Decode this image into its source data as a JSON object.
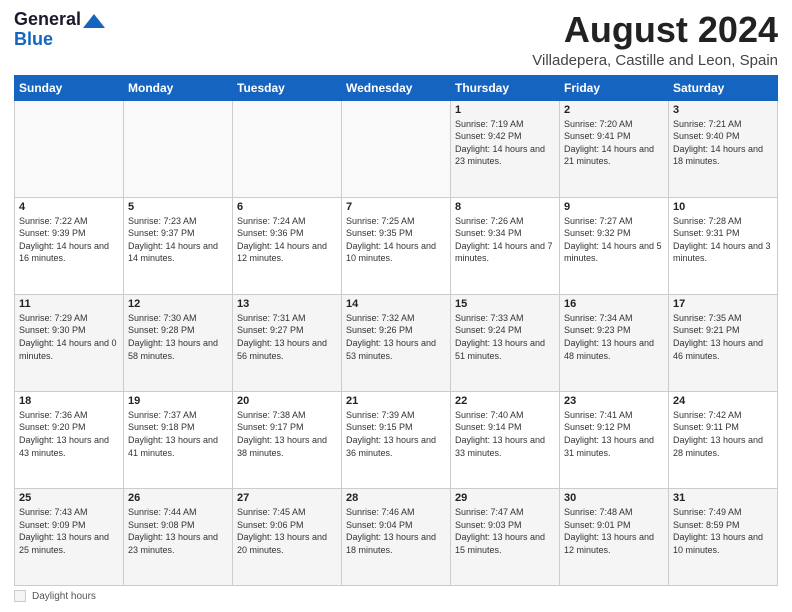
{
  "header": {
    "logo_line1": "General",
    "logo_line2": "Blue",
    "main_title": "August 2024",
    "subtitle": "Villadepera, Castille and Leon, Spain"
  },
  "calendar": {
    "days_of_week": [
      "Sunday",
      "Monday",
      "Tuesday",
      "Wednesday",
      "Thursday",
      "Friday",
      "Saturday"
    ],
    "weeks": [
      [
        {
          "day": "",
          "info": ""
        },
        {
          "day": "",
          "info": ""
        },
        {
          "day": "",
          "info": ""
        },
        {
          "day": "",
          "info": ""
        },
        {
          "day": "1",
          "info": "Sunrise: 7:19 AM\nSunset: 9:42 PM\nDaylight: 14 hours and 23 minutes."
        },
        {
          "day": "2",
          "info": "Sunrise: 7:20 AM\nSunset: 9:41 PM\nDaylight: 14 hours and 21 minutes."
        },
        {
          "day": "3",
          "info": "Sunrise: 7:21 AM\nSunset: 9:40 PM\nDaylight: 14 hours and 18 minutes."
        }
      ],
      [
        {
          "day": "4",
          "info": "Sunrise: 7:22 AM\nSunset: 9:39 PM\nDaylight: 14 hours and 16 minutes."
        },
        {
          "day": "5",
          "info": "Sunrise: 7:23 AM\nSunset: 9:37 PM\nDaylight: 14 hours and 14 minutes."
        },
        {
          "day": "6",
          "info": "Sunrise: 7:24 AM\nSunset: 9:36 PM\nDaylight: 14 hours and 12 minutes."
        },
        {
          "day": "7",
          "info": "Sunrise: 7:25 AM\nSunset: 9:35 PM\nDaylight: 14 hours and 10 minutes."
        },
        {
          "day": "8",
          "info": "Sunrise: 7:26 AM\nSunset: 9:34 PM\nDaylight: 14 hours and 7 minutes."
        },
        {
          "day": "9",
          "info": "Sunrise: 7:27 AM\nSunset: 9:32 PM\nDaylight: 14 hours and 5 minutes."
        },
        {
          "day": "10",
          "info": "Sunrise: 7:28 AM\nSunset: 9:31 PM\nDaylight: 14 hours and 3 minutes."
        }
      ],
      [
        {
          "day": "11",
          "info": "Sunrise: 7:29 AM\nSunset: 9:30 PM\nDaylight: 14 hours and 0 minutes."
        },
        {
          "day": "12",
          "info": "Sunrise: 7:30 AM\nSunset: 9:28 PM\nDaylight: 13 hours and 58 minutes."
        },
        {
          "day": "13",
          "info": "Sunrise: 7:31 AM\nSunset: 9:27 PM\nDaylight: 13 hours and 56 minutes."
        },
        {
          "day": "14",
          "info": "Sunrise: 7:32 AM\nSunset: 9:26 PM\nDaylight: 13 hours and 53 minutes."
        },
        {
          "day": "15",
          "info": "Sunrise: 7:33 AM\nSunset: 9:24 PM\nDaylight: 13 hours and 51 minutes."
        },
        {
          "day": "16",
          "info": "Sunrise: 7:34 AM\nSunset: 9:23 PM\nDaylight: 13 hours and 48 minutes."
        },
        {
          "day": "17",
          "info": "Sunrise: 7:35 AM\nSunset: 9:21 PM\nDaylight: 13 hours and 46 minutes."
        }
      ],
      [
        {
          "day": "18",
          "info": "Sunrise: 7:36 AM\nSunset: 9:20 PM\nDaylight: 13 hours and 43 minutes."
        },
        {
          "day": "19",
          "info": "Sunrise: 7:37 AM\nSunset: 9:18 PM\nDaylight: 13 hours and 41 minutes."
        },
        {
          "day": "20",
          "info": "Sunrise: 7:38 AM\nSunset: 9:17 PM\nDaylight: 13 hours and 38 minutes."
        },
        {
          "day": "21",
          "info": "Sunrise: 7:39 AM\nSunset: 9:15 PM\nDaylight: 13 hours and 36 minutes."
        },
        {
          "day": "22",
          "info": "Sunrise: 7:40 AM\nSunset: 9:14 PM\nDaylight: 13 hours and 33 minutes."
        },
        {
          "day": "23",
          "info": "Sunrise: 7:41 AM\nSunset: 9:12 PM\nDaylight: 13 hours and 31 minutes."
        },
        {
          "day": "24",
          "info": "Sunrise: 7:42 AM\nSunset: 9:11 PM\nDaylight: 13 hours and 28 minutes."
        }
      ],
      [
        {
          "day": "25",
          "info": "Sunrise: 7:43 AM\nSunset: 9:09 PM\nDaylight: 13 hours and 25 minutes."
        },
        {
          "day": "26",
          "info": "Sunrise: 7:44 AM\nSunset: 9:08 PM\nDaylight: 13 hours and 23 minutes."
        },
        {
          "day": "27",
          "info": "Sunrise: 7:45 AM\nSunset: 9:06 PM\nDaylight: 13 hours and 20 minutes."
        },
        {
          "day": "28",
          "info": "Sunrise: 7:46 AM\nSunset: 9:04 PM\nDaylight: 13 hours and 18 minutes."
        },
        {
          "day": "29",
          "info": "Sunrise: 7:47 AM\nSunset: 9:03 PM\nDaylight: 13 hours and 15 minutes."
        },
        {
          "day": "30",
          "info": "Sunrise: 7:48 AM\nSunset: 9:01 PM\nDaylight: 13 hours and 12 minutes."
        },
        {
          "day": "31",
          "info": "Sunrise: 7:49 AM\nSunset: 8:59 PM\nDaylight: 13 hours and 10 minutes."
        }
      ]
    ]
  },
  "footer": {
    "daylight_label": "Daylight hours"
  }
}
